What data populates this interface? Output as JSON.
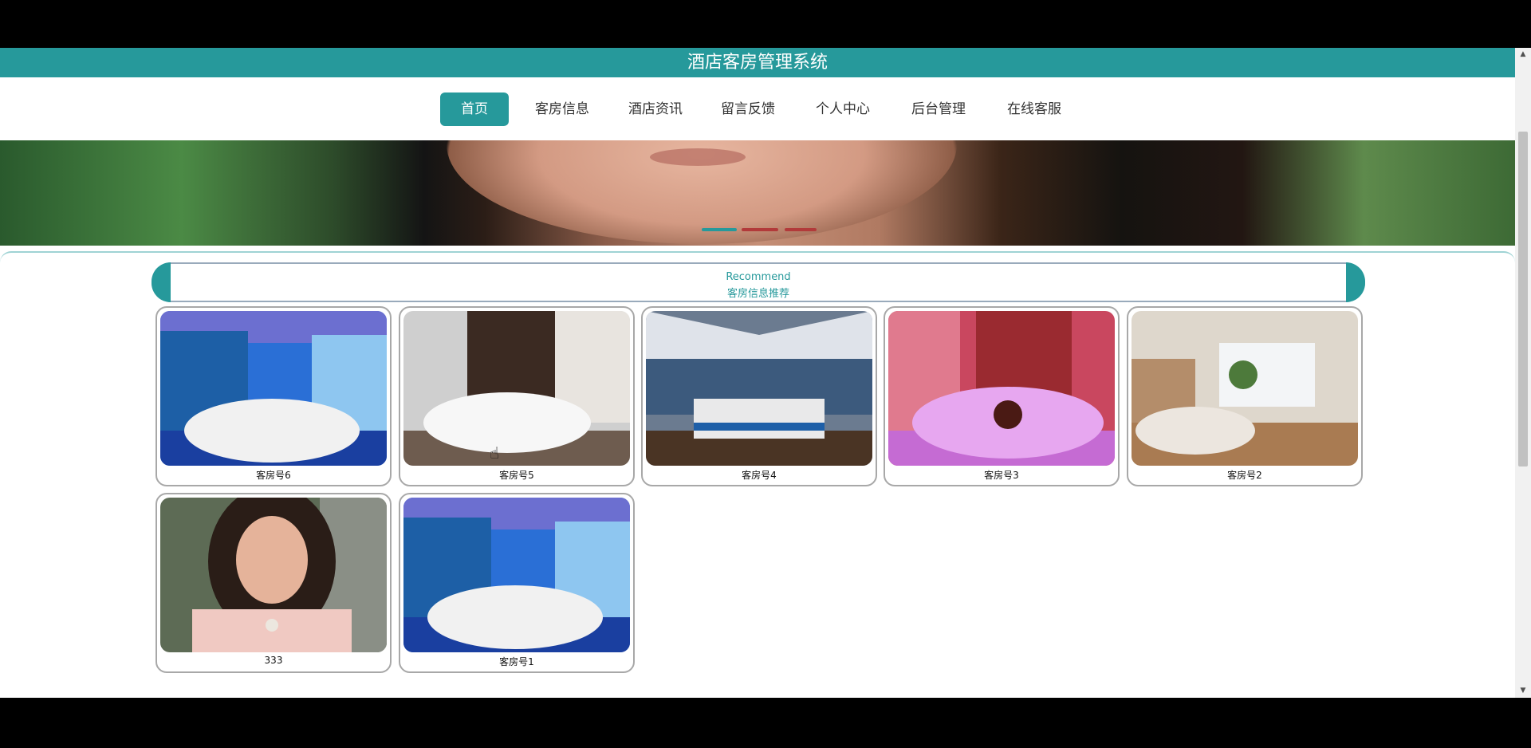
{
  "app": {
    "title": "酒店客房管理系统"
  },
  "nav": {
    "items": [
      {
        "label": "首页",
        "active": true
      },
      {
        "label": "客房信息",
        "active": false
      },
      {
        "label": "酒店资讯",
        "active": false
      },
      {
        "label": "留言反馈",
        "active": false
      },
      {
        "label": "个人中心",
        "active": false
      },
      {
        "label": "后台管理",
        "active": false
      },
      {
        "label": "在线客服",
        "active": false
      }
    ]
  },
  "banner": {
    "active_slide": 1,
    "slide_count": 3
  },
  "recommend": {
    "title_en": "Recommend",
    "title_cn": "客房信息推荐",
    "cards": [
      {
        "label": "客房号6",
        "image": "blue-ocean-room"
      },
      {
        "label": "客房号5",
        "image": "modern-white-room"
      },
      {
        "label": "客房号4",
        "image": "tent-ocean-room"
      },
      {
        "label": "客房号3",
        "image": "pink-romance-room"
      },
      {
        "label": "客房号2",
        "image": "bright-suite-room"
      },
      {
        "label": "333",
        "image": "woman-portrait"
      },
      {
        "label": "客房号1",
        "image": "blue-ocean-room"
      }
    ]
  },
  "colors": {
    "brand": "#26999b",
    "nav_active": "#26999b",
    "card_border": "#a8a8a8",
    "dot_active": "#26999b",
    "dot_inactive": "#b23a3a"
  },
  "icons": {
    "scroll_up": "triangle-up-icon",
    "scroll_down": "triangle-down-icon",
    "cursor": "hand-pointer-icon"
  }
}
